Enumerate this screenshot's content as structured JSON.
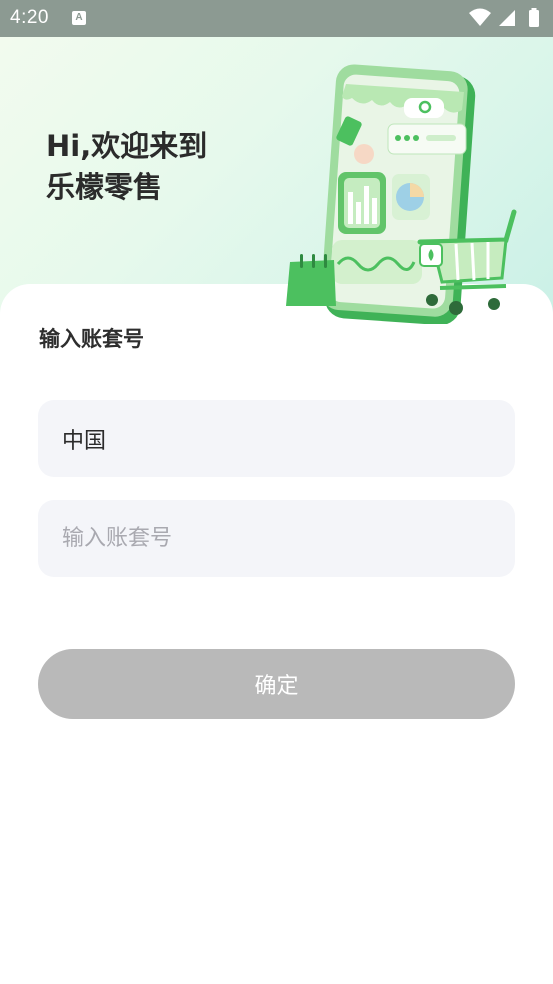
{
  "status_bar": {
    "time": "4:20",
    "notification_icon": "a-icon",
    "wifi_icon": "wifi-icon",
    "signal_icon": "signal-icon",
    "battery_icon": "battery-icon"
  },
  "hero": {
    "greeting_line1": "Hi,欢迎来到",
    "greeting_line2": "乐檬零售",
    "illustration": "shop-phone-cart-illustration"
  },
  "form": {
    "section_label": "输入账套号",
    "region_value": "中国",
    "account_value": "",
    "account_placeholder": "输入账套号",
    "confirm_label": "确定"
  },
  "colors": {
    "accent_green": "#4cc05f",
    "disabled_button": "#b9b9b9",
    "field_bg": "#f4f5f9",
    "status_bar": "#8c9a92"
  }
}
